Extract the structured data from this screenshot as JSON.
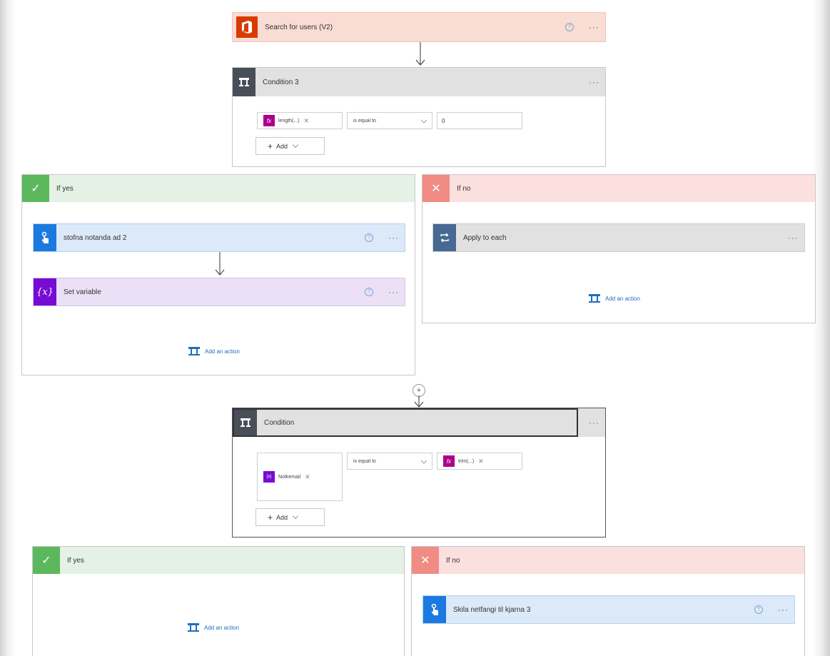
{
  "flow": {
    "search_users": {
      "title": "Search for users (V2)",
      "color": "#d83b01"
    },
    "condition3": {
      "title": "Condition 3",
      "left_token": "length(...)",
      "operator": "is equal to",
      "right_value": "0",
      "add_label": "Add"
    },
    "yes_branch_1": {
      "label": "If yes",
      "action1": "stofna notanda ad 2",
      "action2": "Set variable",
      "add_action": "Add an action"
    },
    "no_branch_1": {
      "label": "If no",
      "action1": "Apply to each",
      "add_action": "Add an action"
    },
    "condition": {
      "title": "Condition",
      "left_token": "Notkemail",
      "operator": "is equal to",
      "right_token": "trim(...)",
      "add_label": "Add"
    },
    "yes_branch_2": {
      "label": "If yes",
      "add_action": "Add an action"
    },
    "no_branch_2": {
      "label": "If no",
      "action1": "Skila netfangi til kjarna 3"
    }
  },
  "icons": {
    "help": "?",
    "more": "···",
    "check": "✓",
    "cross": "✕",
    "fx": "fx",
    "variable": "{x}",
    "add_circle": "+"
  }
}
